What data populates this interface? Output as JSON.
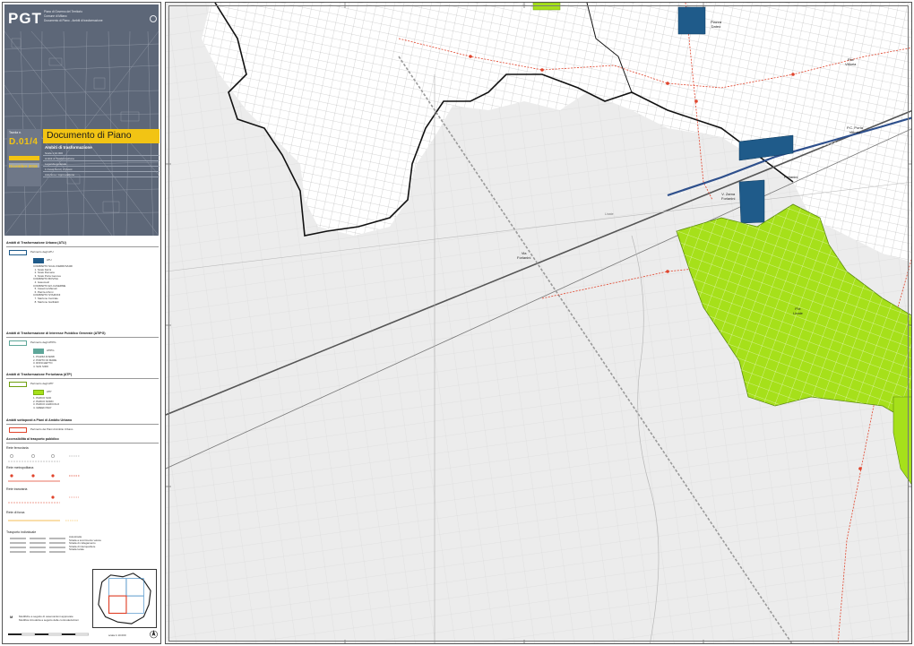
{
  "header": {
    "logo": "PGT",
    "line1": "Piano di Governo del Territorio",
    "line2": "Comune di Milano",
    "line3": "Documento di Piano - Ambiti di trasformazione"
  },
  "document": {
    "number_label": "Tavola n.",
    "number": "D.01/4",
    "title": "Documento di Piano",
    "subtitle": "Ambiti di trasformazione",
    "row1": "Scala 1:10.000",
    "row2": "Ambiti di Trasformazione",
    "row3": "Legenda generale",
    "row4": "1 Ovest Nord  |  2 Ovest",
    "row5": "Adozione / Approvazione",
    "date": "Dicembre 2016"
  },
  "legend": {
    "atu": {
      "heading": "Ambiti di Trasformazione Urbana (ATU)",
      "boundary_text": "Perimetro degli ATU",
      "fill_code": "ATU",
      "items": "COMPARTO SCALI FERROVIARI\n  1. Scalo Farini\n  2. Scalo Romana\n  3. Scalo Porta Genova\nCOMPARTO BOVISA\n  4. Gasometri\nCOMPARTO EX-CASERME\n  5. Caserma Mameli\n  6. Piazza d'Armi\nCOMPARTO STAZIONI\n  7. Stazione Centrale\n  8. Stazione Garibaldi"
    },
    "atip": {
      "heading": "Ambiti di Trasformazione di Interesse Pubblico Generale (ATIPG)",
      "boundary_text": "Perimetro degli ATIPG",
      "fill_code": "ATIPG",
      "items": "1. PIAZZA D'ARMI\n2. PORTO DI MARE\n3. RONCHETTO\n4. SAN SIRO"
    },
    "atp": {
      "heading": "Ambiti di Trasformazione Periurbana (ATP)",
      "boundary_text": "Perimetro degli ATP",
      "fill_code": "ATP",
      "items": "1. PARCO SUD\n2. PARCO NORD\n3. PARCO AGRICOLO\n4. GREEN WAY"
    },
    "pa": {
      "heading": "Ambiti sottoposti a Piani di Ambito Urbano",
      "boundary_text": "Perimetro dei Piani di Ambito Urbano"
    },
    "access_heading": "Accessibilità al trasporto pubblico",
    "rail_heading": "Rete ferroviaria",
    "metro_heading": "Rete metropolitana",
    "tram_heading": "Rete tranviaria",
    "bus_heading": "Rete di forza",
    "strade_heading": "Trasporto individuale",
    "road_labels": "Autostrada\nStrada a scorrimento veloce\nStrada di collegamento\nStrada di interquartiere\nStrada locale"
  },
  "footnote": {
    "mark": "M",
    "text": "Modifiche a seguito di osservazioni approvate\nModifica introdotta a seguito delle controdeduzioni"
  },
  "scale": {
    "label": "scala 1:10.000",
    "ticks": [
      "0",
      "100",
      "200",
      "300",
      "400",
      "500"
    ]
  },
  "map": {
    "labels": [
      {
        "text": "Piazza\nDateo",
        "class": "dark"
      },
      {
        "text": "P.ta\nVittoria",
        "class": "dark"
      },
      {
        "text": "P.C. Porta\nVittoria",
        "class": "dark"
      },
      {
        "text": "Forlanini",
        "class": "dark"
      },
      {
        "text": "V. Zama\nForlanini",
        "class": "dark"
      },
      {
        "text": "P.le\nLinate",
        "class": "dark"
      },
      {
        "text": "Via\nForlanini",
        "class": "dark"
      },
      {
        "text": "Linate",
        "class": "light"
      }
    ]
  },
  "colors": {
    "header_bg": "#5d6778",
    "accent_yellow": "#f2c414",
    "atu_blue": "#1f5b8a",
    "atp_green": "#a6e01a",
    "atip_teal": "#5fa79a",
    "rail_red": "#e0442c",
    "metro_blue": "#2d4f8c"
  }
}
